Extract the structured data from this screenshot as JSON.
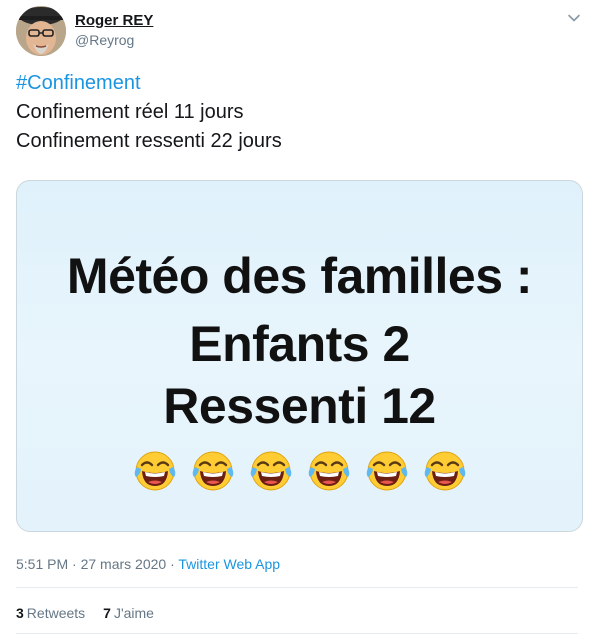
{
  "author": {
    "name": "Roger REY",
    "handle": "@Reyrog"
  },
  "tweet": {
    "hashtag": "#Confinement",
    "lines": [
      "Confinement réel 11 jours",
      "Confinement ressenti 22 jours"
    ]
  },
  "media": {
    "lines": [
      "Météo des familles :",
      "Enfants 2",
      "Ressenti 12"
    ],
    "emoji_icon": "face-with-tears-of-joy",
    "emoji_count": 6
  },
  "meta": {
    "time": "5:51 PM",
    "date": "27 mars 2020",
    "separator": "·",
    "app": "Twitter Web App"
  },
  "stats": {
    "retweets_count": "3",
    "retweets_label": "Retweets",
    "likes_count": "7",
    "likes_label": "J'aime"
  },
  "colors": {
    "link": "#1b95e0",
    "secondary_text": "#657786"
  }
}
